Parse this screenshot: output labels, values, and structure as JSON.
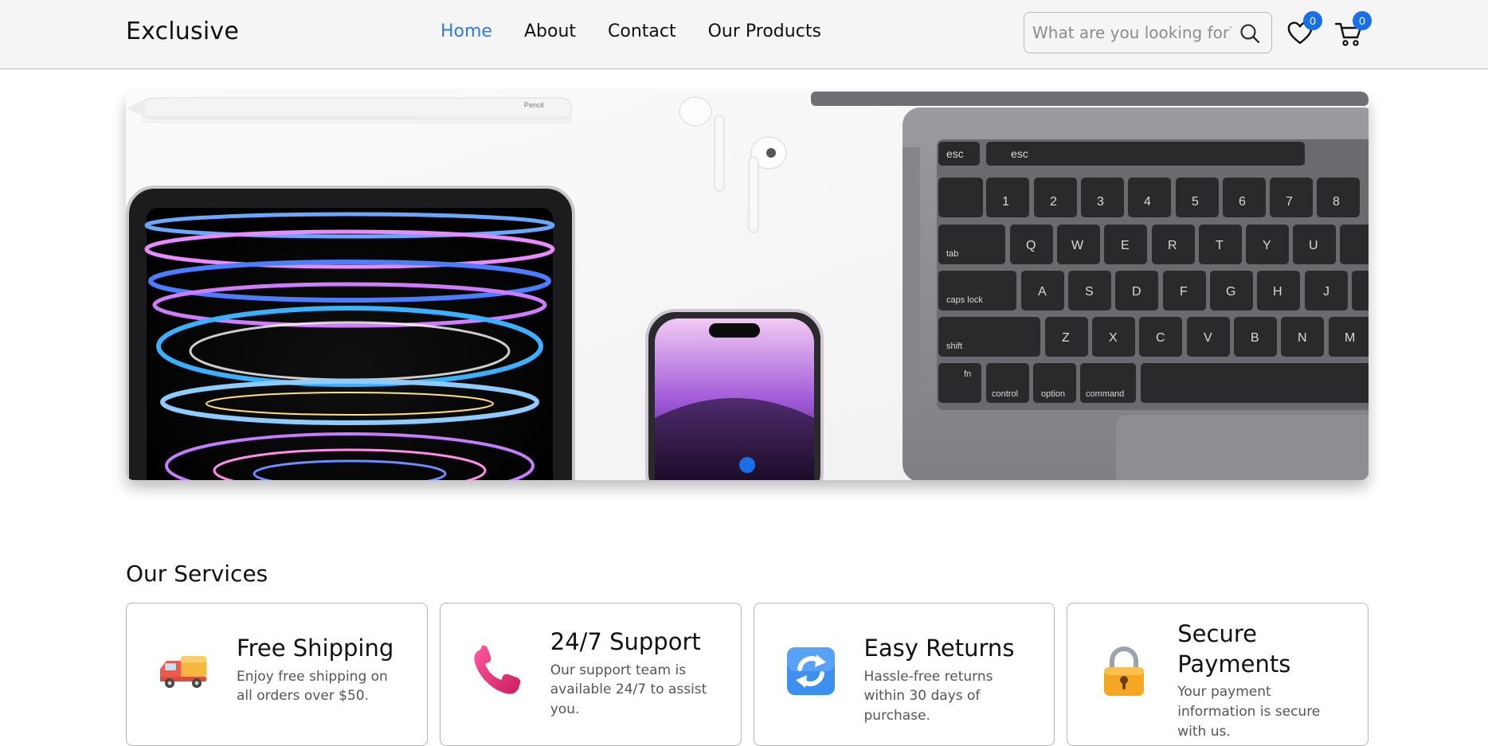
{
  "header": {
    "logo": "Exclusive",
    "nav": [
      {
        "label": "Home",
        "active": true
      },
      {
        "label": "About",
        "active": false
      },
      {
        "label": "Contact",
        "active": false
      },
      {
        "label": "Our Products",
        "active": false
      }
    ],
    "search": {
      "placeholder": "What are you looking for?",
      "value": ""
    },
    "wishlist": {
      "icon": "heart-icon",
      "count": "0"
    },
    "cart": {
      "icon": "cart-icon",
      "count": "0"
    },
    "accent_color": "#2f7be5",
    "badge_color": "#1a6ee6"
  },
  "hero": {
    "products": [
      "apple-pencil",
      "airpods",
      "macbook",
      "ipad",
      "iphone"
    ],
    "carousel": {
      "total_dots": 1,
      "active": 1
    }
  },
  "services": {
    "title": "Our Services",
    "items": [
      {
        "icon": "delivery-truck-icon",
        "title": "Free Shipping",
        "description": "Enjoy free shipping on all orders over $50."
      },
      {
        "icon": "phone-icon",
        "title": "24/7 Support",
        "description": "Our support team is available 24/7 to assist you."
      },
      {
        "icon": "refresh-icon",
        "title": "Easy Returns",
        "description": "Hassle-free returns within 30 days of purchase."
      },
      {
        "icon": "padlock-icon",
        "title": "Secure Payments",
        "description": "Your payment information is secure with us."
      }
    ]
  }
}
